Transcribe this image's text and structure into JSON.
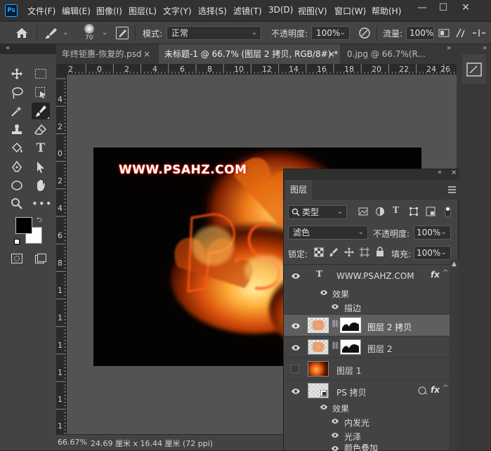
{
  "menubar": {
    "logo": "Ps",
    "items": [
      "文件(F)",
      "编辑(E)",
      "图像(I)",
      "图层(L)",
      "文字(Y)",
      "选择(S)",
      "滤镜(T)",
      "3D(D)",
      "视图(V)",
      "窗口(W)",
      "帮助(H)"
    ],
    "window_controls": [
      "—",
      "☐",
      "✕"
    ]
  },
  "options": {
    "brush_size": "70",
    "mode_label": "模式:",
    "mode_value": "正常",
    "opacity_label": "不透明度:",
    "opacity_value": "100%",
    "flow_label": "流量:",
    "flow_value": "100%"
  },
  "tabs": [
    {
      "label": "年终钜惠-恢复的.psd",
      "close": "×"
    },
    {
      "label": "未标题-1 @ 66.7% (图层 2 拷贝, RGB/8#) *",
      "close": "×"
    },
    {
      "label": "0.jpg @ 66.7%(R...",
      "close": ""
    }
  ],
  "ruler": {
    "top_ticks": [
      "2",
      "0",
      "2",
      "4",
      "6",
      "8",
      "10",
      "12",
      "14",
      "16",
      "18",
      "20",
      "22",
      "24",
      "26"
    ],
    "left_ticks": [
      "4",
      "2",
      "0",
      "2",
      "4",
      "6",
      "8",
      "1",
      "1",
      "1",
      "1",
      "1",
      "1",
      "1",
      "1"
    ]
  },
  "document": {
    "title_text": "WWW.PSAHZ.COM"
  },
  "status": {
    "zoom": "66.67%",
    "doc_size": "24.69 厘米 x 16.44 厘米 (72 ppi)"
  },
  "layers_panel": {
    "tab_label": "图层",
    "filter_kind": "类型",
    "blend_mode": "滤色",
    "opacity_label": "不透明度:",
    "opacity_value": "100%",
    "lock_label": "锁定:",
    "fill_label": "填充:",
    "fill_value": "100%",
    "type_glyph": "T",
    "layers": [
      {
        "name": "WWW.PSAHZ.COM",
        "fx": "fx"
      },
      {
        "name": "效果"
      },
      {
        "name": "描边"
      },
      {
        "name": "图层 2 拷贝"
      },
      {
        "name": "图层 2"
      },
      {
        "name": "图层 1"
      },
      {
        "name": "PS 拷贝",
        "fx": "fx"
      },
      {
        "name": "效果"
      },
      {
        "name": "内发光"
      },
      {
        "name": "光泽"
      },
      {
        "name": "颜色叠加"
      }
    ]
  },
  "colors": {
    "foreground": "#000000",
    "background": "#ffffff",
    "accent": "#31a8ff"
  }
}
